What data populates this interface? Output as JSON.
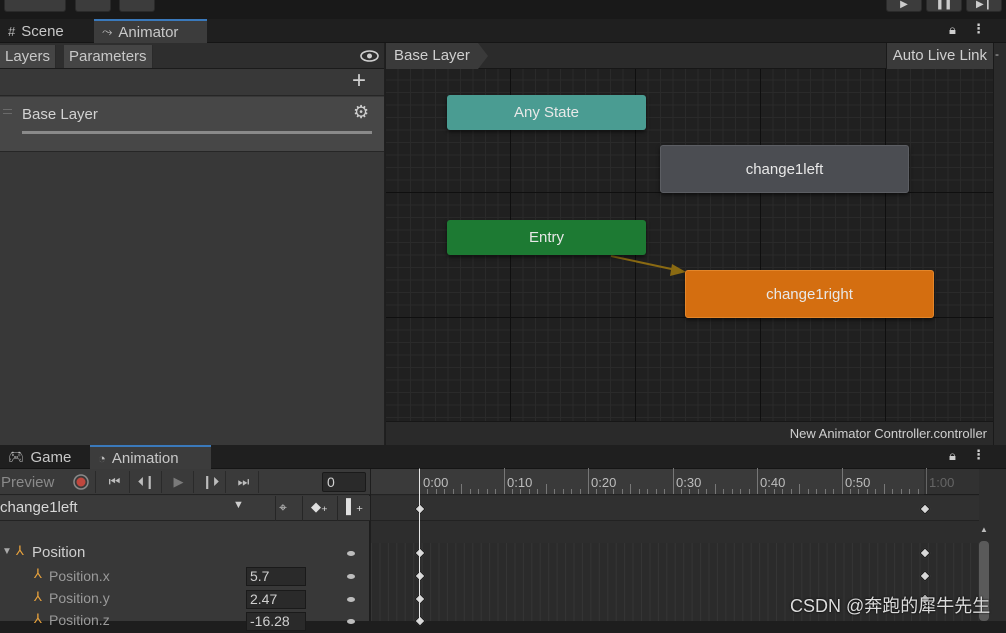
{
  "top_tabs": [
    {
      "label": "Scene",
      "icon": "grid-icon",
      "active": false
    },
    {
      "label": "Animator",
      "icon": "animator-icon",
      "active": true
    }
  ],
  "layers_panel": {
    "tabs": [
      "Layers",
      "Parameters"
    ],
    "layer_name": "Base Layer"
  },
  "graph": {
    "breadcrumb": "Base Layer",
    "auto_live_link": "Auto Live Link",
    "footer": "New Animator Controller.controller",
    "nodes": {
      "any_state": "Any State",
      "change1left": "change1left",
      "entry": "Entry",
      "change1right": "change1right"
    },
    "colors": {
      "any_state": "#4a9c92",
      "default_state": "#4b4d52",
      "entry": "#1d7a33",
      "selected_state": "#d46e10",
      "transition": "#8a6a12"
    }
  },
  "bottom_tabs": [
    {
      "label": "Game",
      "icon": "gamepad-icon",
      "active": false
    },
    {
      "label": "Animation",
      "icon": "clock-icon",
      "active": true
    }
  ],
  "animation": {
    "preview_label": "Preview",
    "frame": "0",
    "clip": "change1left",
    "timeline_labels": [
      "0:00",
      "0:10",
      "0:20",
      "0:30",
      "0:40",
      "0:50",
      "1:00"
    ],
    "properties": [
      {
        "name": "Position",
        "value": "",
        "group": true
      },
      {
        "name": "Position.x",
        "value": "5.7",
        "group": false
      },
      {
        "name": "Position.y",
        "value": "2.47",
        "group": false
      },
      {
        "name": "Position.z",
        "value": "-16.28",
        "group": false
      }
    ]
  },
  "watermark": "CSDN @奔跑的犀牛先生"
}
